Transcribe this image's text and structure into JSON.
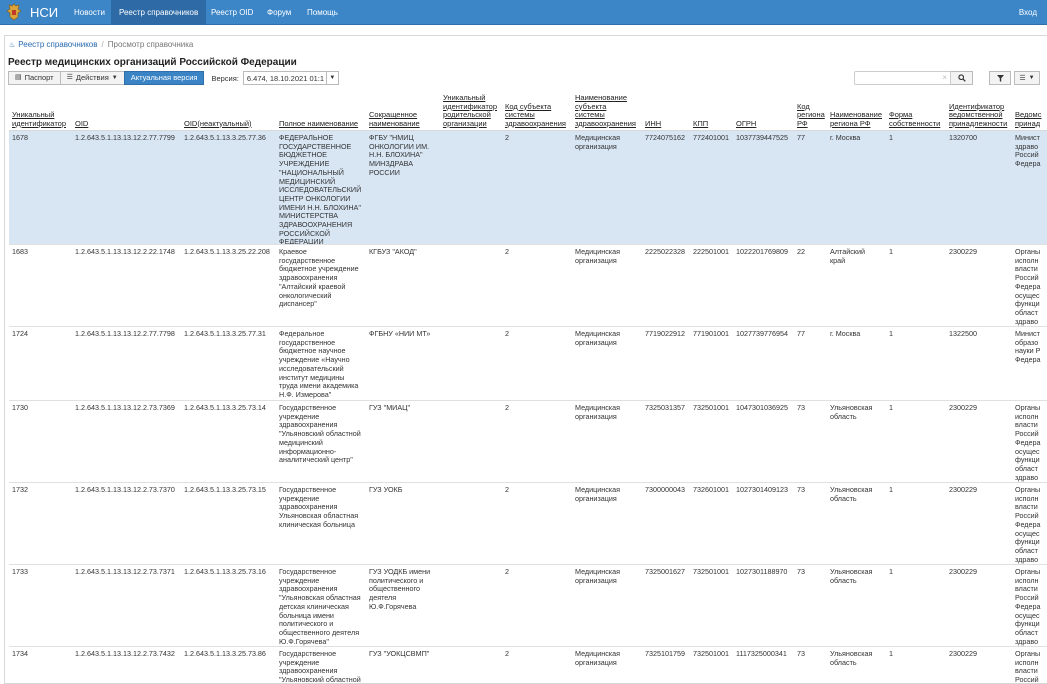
{
  "navbar": {
    "brand": "НСИ",
    "items": [
      "Новости",
      "Реестр справочников",
      "Реестр OID",
      "Форум",
      "Помощь"
    ],
    "active_index": 1,
    "login": "Вход"
  },
  "breadcrumb": {
    "link": "Реестр справочников",
    "separator": "/",
    "current": "Просмотр справочника"
  },
  "page_title": "Реестр медицинских организаций Российской Федерации",
  "toolbar": {
    "passport": "Паспорт",
    "actions": "Действия",
    "current_version": "Актуальная версия",
    "version_label": "Версия:",
    "version_value": "6.474, 18.10.2021 01:1"
  },
  "search": {
    "placeholder": "",
    "clear": "×"
  },
  "colors": {
    "navbar": "#3c86c8",
    "accent": "#3a84c6",
    "selected_row": "#d8e6f4"
  },
  "table": {
    "headers": [
      "Уникальный\nидентификатор",
      "OID",
      "OID(неактуальный)",
      "Полное наименование",
      "Сокращенное\nнаименование",
      "Уникальный\nидентификатор\nродительской\nорганизации",
      "Код субъекта\nсистемы\nздравоохранения",
      "Наименование\nсубъекта\nсистемы\nздравоохранения",
      "ИНН",
      "КПП",
      "ОГРН",
      "Код\nрегиона\nРФ",
      "Наименование\nрегиона РФ",
      "Форма\nсобственности",
      "Идентификатор\nведомственной\nпринадлежности",
      "Ведомс\nпринад"
    ],
    "rows": [
      {
        "selected": true,
        "cells": [
          "1678",
          "1.2.643.5.1.13.13.12.2.77.7799",
          "1.2.643.5.1.13.3.25.77.36",
          "ФЕДЕРАЛЬНОЕ\nГОСУДАРСТВЕННОЕ\nБЮДЖЕТНОЕ\nУЧРЕЖДЕНИЕ\n\"НАЦИОНАЛЬНЫЙ\nМЕДИЦИНСКИЙ\nИССЛЕДОВАТЕЛЬСКИЙ\nЦЕНТР ОНКОЛОГИИ\nИМЕНИ Н.Н. БЛОХИНА\"\nМИНИСТЕРСТВА\nЗДРАВООХРАНЕНИЯ\nРОССИЙСКОЙ\nФЕДЕРАЦИИ",
          "ФГБУ \"НМИЦ\nОНКОЛОГИИ ИМ.\nН.Н. БЛОХИНА\"\nМИНЗДРАВА\nРОССИИ",
          "",
          "2",
          "Медицинская\nорганизация",
          "7724075162",
          "772401001",
          "1037739447525",
          "77",
          "г. Москва",
          "1",
          "1320700",
          "Минист\nздраво\nРоссий\nФедера"
        ]
      },
      {
        "selected": false,
        "cells": [
          "1683",
          "1.2.643.5.1.13.13.12.2.22.1748",
          "1.2.643.5.1.13.3.25.22.208",
          "Краевое\nгосударственное\nбюджетное учреждение\nздравоохранения\n\"Алтайский краевой\nонкологический\nдиспансер\"",
          "КГБУЗ \"АКОД\"",
          "",
          "2",
          "Медицинская\nорганизация",
          "2225022328",
          "222501001",
          "1022201769809",
          "22",
          "Алтайский\nкрай",
          "1",
          "2300229",
          "Органы\nисполн\nвласти\nРоссий\nФедера\nосущес\nфункци\nобласт\nздраво"
        ]
      },
      {
        "selected": false,
        "cells": [
          "1724",
          "1.2.643.5.1.13.13.12.2.77.7798",
          "1.2.643.5.1.13.3.25.77.31",
          "Федеральное\nгосударственное\nбюджетное научное\nучреждение «Научно\nисследовательский\nинститут медицины\nтруда имени академика\nН.Ф. Измерова\"",
          "ФГБНУ «НИИ МТ»",
          "",
          "2",
          "Медицинская\nорганизация",
          "7719022912",
          "771901001",
          "1027739776954",
          "77",
          "г. Москва",
          "1",
          "1322500",
          "Минист\nобразо\nнауки Р\nФедера"
        ]
      },
      {
        "selected": false,
        "cells": [
          "1730",
          "1.2.643.5.1.13.13.12.2.73.7369",
          "1.2.643.5.1.13.3.25.73.14",
          "Государственное\nучреждение\nздравоохранения\n\"Ульяновский областной\nмедицинский\nинформационно-\nаналитический центр\"",
          "ГУЗ \"МИАЦ\"",
          "",
          "2",
          "Медицинская\nорганизация",
          "7325031357",
          "732501001",
          "1047301036925",
          "73",
          "Ульяновская\nобласть",
          "1",
          "2300229",
          "Органы\nисполн\nвласти\nРоссий\nФедера\nосущес\nфункци\nобласт\nздраво"
        ]
      },
      {
        "selected": false,
        "cells": [
          "1732",
          "1.2.643.5.1.13.13.12.2.73.7370",
          "1.2.643.5.1.13.3.25.73.15",
          "Государственное\nучреждение\nздравоохранения\nУльяновская областная\nклиническая больница",
          "ГУЗ УОКБ",
          "",
          "2",
          "Медицинская\nорганизация",
          "7300000043",
          "732601001",
          "1027301409123",
          "73",
          "Ульяновская\nобласть",
          "1",
          "2300229",
          "Органы\nисполн\nвласти\nРоссий\nФедера\nосущес\nфункци\nобласт\nздраво"
        ]
      },
      {
        "selected": false,
        "cells": [
          "1733",
          "1.2.643.5.1.13.13.12.2.73.7371",
          "1.2.643.5.1.13.3.25.73.16",
          "Государственное\nучреждение\nздравоохранения\n\"Ульяновская областная\nдетская клиническая\nбольница имени\nполитического и\nобщественного деятеля\nЮ.Ф.Горячева\"",
          "ГУЗ УОДКБ имени\nполитического и\nобщественного\nдеятеля\nЮ.Ф.Горячева",
          "",
          "2",
          "Медицинская\nорганизация",
          "7325001627",
          "732501001",
          "1027301188970",
          "73",
          "Ульяновская\nобласть",
          "1",
          "2300229",
          "Органы\nисполн\nвласти\nРоссий\nФедера\nосущес\nфункци\nобласт\nздраво"
        ]
      },
      {
        "selected": false,
        "cells": [
          "1734",
          "1.2.643.5.1.13.13.12.2.73.7432",
          "1.2.643.5.1.13.3.25.73.86",
          "Государственное\nучреждение\nздравоохранения\n\"Ульяновский областной",
          "ГУЗ \"УОКЦСВМП\"",
          "",
          "2",
          "Медицинская\nорганизация",
          "7325101759",
          "732501001",
          "1117325000341",
          "73",
          "Ульяновская\nобласть",
          "1",
          "2300229",
          "Органы\nисполн\nвласти\nРоссий"
        ]
      }
    ]
  }
}
